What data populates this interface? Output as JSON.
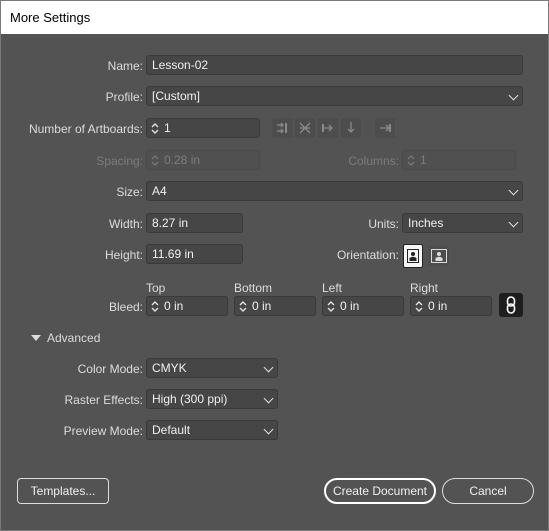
{
  "window": {
    "title": "More Settings"
  },
  "name": {
    "label": "Name:",
    "value": "Lesson-02"
  },
  "profile": {
    "label": "Profile:",
    "value": "[Custom]"
  },
  "artboards": {
    "label": "Number of Artboards:",
    "value": "1"
  },
  "spacing": {
    "label": "Spacing:",
    "value": "0.28 in"
  },
  "columns": {
    "label": "Columns:",
    "value": "1"
  },
  "size": {
    "label": "Size:",
    "value": "A4"
  },
  "width": {
    "label": "Width:",
    "value": "8.27 in"
  },
  "units": {
    "label": "Units:",
    "value": "Inches"
  },
  "height": {
    "label": "Height:",
    "value": "11.69 in"
  },
  "orientation": {
    "label": "Orientation:"
  },
  "bleed": {
    "label": "Bleed:",
    "top": {
      "label": "Top",
      "value": "0 in"
    },
    "bottom": {
      "label": "Bottom",
      "value": "0 in"
    },
    "left": {
      "label": "Left",
      "value": "0 in"
    },
    "right": {
      "label": "Right",
      "value": "0 in"
    }
  },
  "advanced": {
    "label": "Advanced",
    "color_mode": {
      "label": "Color Mode:",
      "value": "CMYK"
    },
    "raster_effects": {
      "label": "Raster Effects:",
      "value": "High (300 ppi)"
    },
    "preview_mode": {
      "label": "Preview Mode:",
      "value": "Default"
    }
  },
  "buttons": {
    "templates": "Templates...",
    "create": "Create Document",
    "cancel": "Cancel"
  },
  "icons": [
    "spinner-arrows-icon",
    "arrange-by-grid-icon",
    "arrange-by-row-icon",
    "arrange-by-column-icon",
    "arrange-single-column-icon",
    "layout-direction-icon",
    "portrait-icon",
    "landscape-icon",
    "link-icon",
    "triangle-down-icon",
    "chevron-down-icon"
  ]
}
